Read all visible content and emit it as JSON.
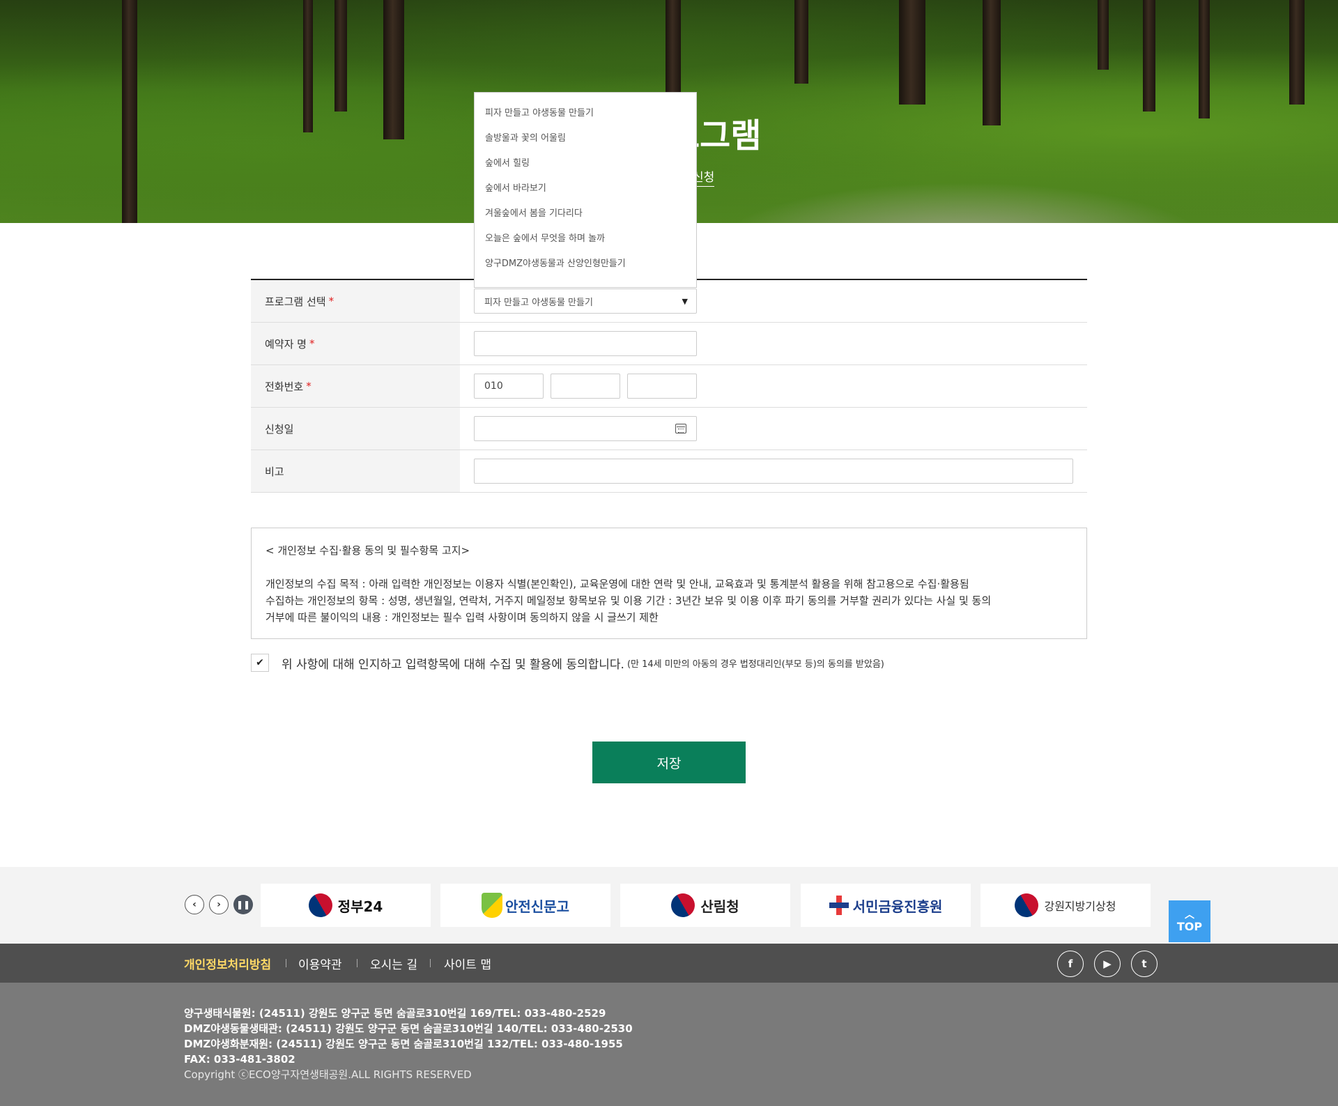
{
  "hero": {
    "title": "체험프로그램",
    "breadcrumb": "체험프로그램 신청"
  },
  "form": {
    "program": {
      "label": "프로그램 선택",
      "value": "피자 만들고 야생동물 만들기"
    },
    "name": {
      "label": "예약자 명",
      "value": ""
    },
    "phone": {
      "label": "전화번호",
      "part1": "010",
      "part2": "",
      "part3": ""
    },
    "date": {
      "label": "신청일",
      "value": ""
    },
    "note": {
      "label": "비고",
      "value": ""
    },
    "required_mark": "*"
  },
  "dropdown": {
    "options": [
      "피자 만들고 야생동물 만들기",
      "솔방울과 꽃의 어울림",
      "숲에서 힐링",
      "숲에서 바라보기",
      "겨울숲에서 봄을 기다리다",
      "오늘은 숲에서 무엇을 하며 놀까",
      "양구DMZ야생동물과 산양인형만들기"
    ]
  },
  "privacy": {
    "title": "< 개인정보 수집·활용 동의 및 필수항목 고지>",
    "line1": "개인정보의 수집 목적 : 아래 입력한 개인정보는 이용자 식별(본인확인), 교육운영에 대한 연락 및 안내, 교육효과 및 통계분석 활용을 위해 참고용으로 수집·활용됨",
    "line2": "수집하는 개인정보의 항목 : 성명, 생년월일, 연락처, 거주지 메일정보 항목보유 및 이용 기간 : 3년간 보유 및 이용 이후 파기 동의를 거부할 권리가 있다는 사실 및 동의",
    "line3": "거부에 따른 불이익의 내용 : 개인정보는 필수 입력 사항이며 동의하지 않을 시 글쓰기 제한",
    "agree_text": "위 사항에 대해 인지하고 입력항목에 대해 수집 및 활용에 동의합니다.",
    "agree_note": "(만 14세 미만의 아동의 경우 법정대리인(부모 등)의 동의를 받았음)",
    "agree_checked": true
  },
  "save_label": "저장",
  "banners": {
    "items": [
      "정부24",
      "안전신문고",
      "산림청",
      "서민금융진흥원",
      "강원지방기상청"
    ]
  },
  "top_label": "TOP",
  "footer": {
    "links": [
      "개인정보처리방침",
      "이용약관",
      "오시는 길",
      "사이트 맵"
    ],
    "social": [
      "facebook-icon",
      "youtube-icon",
      "twitter-icon"
    ],
    "addr1": "양구생태식물원: (24511) 강원도 양구군 동면 숨골로310번길 169/TEL: 033-480-2529",
    "addr2": "DMZ야생동물생태관: (24511) 강원도 양구군 동면 숨골로310번길 140/TEL: 033-480-2530",
    "addr3": "DMZ야생화분재원: (24511) 강원도 양구군 동면 숨골로310번길 132/TEL: 033-480-1955",
    "fax": "FAX: 033-481-3802",
    "copyright": "Copyright ⓒECO양구자연생태공원.ALL RIGHTS RESERVED"
  },
  "colors": {
    "primary_button": "#0a7f5a",
    "top_button": "#3ea0f0",
    "required": "#e02020"
  }
}
